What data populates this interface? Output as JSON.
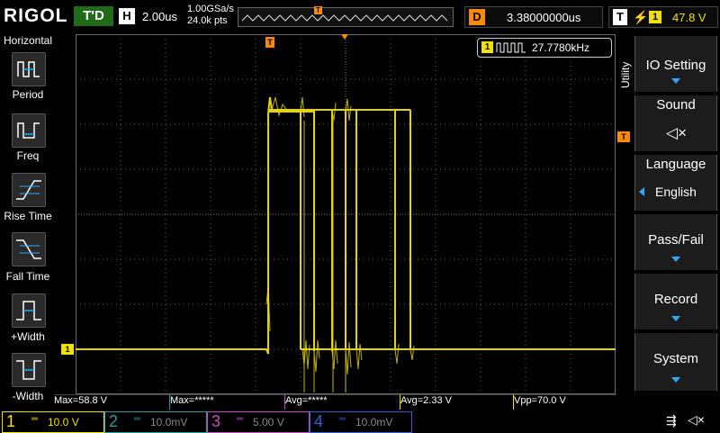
{
  "top": {
    "logo": "RIGOL",
    "run_state": "T'D",
    "horiz_label": "H",
    "timebase": "2.00us",
    "sample_rate": "1.00GSa/s",
    "mem_depth": "24.0k pts",
    "trig_marker": "T",
    "delay_label": "D",
    "delay_value": "3.38000000us",
    "trig_label": "T",
    "trig_channel": "1",
    "trig_level": "47.8 V"
  },
  "left_menu": {
    "title": "Horizontal",
    "items": [
      {
        "label": "Period"
      },
      {
        "label": "Freq"
      },
      {
        "label": "Rise Time"
      },
      {
        "label": "Fall Time"
      },
      {
        "label": "+Width"
      },
      {
        "label": "-Width"
      }
    ]
  },
  "freq_counter": {
    "channel": "1",
    "value": "27.7780kHz"
  },
  "right_menu": {
    "title": "Utility",
    "items": [
      {
        "label": "IO Setting"
      },
      {
        "label": "Sound"
      },
      {
        "label": "Language",
        "value": "English"
      },
      {
        "label": "Pass/Fail"
      },
      {
        "label": "Record"
      },
      {
        "label": "System"
      }
    ]
  },
  "measurements": [
    {
      "text": "Max=58.8 V"
    },
    {
      "text": "Max=*****"
    },
    {
      "text": "Avg=*****"
    },
    {
      "text": "Avg=2.33 V"
    },
    {
      "text": "Vpp=70.0 V"
    }
  ],
  "channels": [
    {
      "num": "1",
      "scale": "10.0 V",
      "color": "#f0e000"
    },
    {
      "num": "2",
      "scale": "10.0mV",
      "color": "#1aa0a0"
    },
    {
      "num": "3",
      "scale": "5.00 V",
      "color": "#c050c0"
    },
    {
      "num": "4",
      "scale": "10.0mV",
      "color": "#3060d0"
    }
  ],
  "ch1_marker": "1",
  "trig_level_marker": "T",
  "colors": {
    "ch1": "#f0e000",
    "grid": "#6a6a6a",
    "accent": "#2ea8ff",
    "trigger_orange": "#ff8a00"
  }
}
